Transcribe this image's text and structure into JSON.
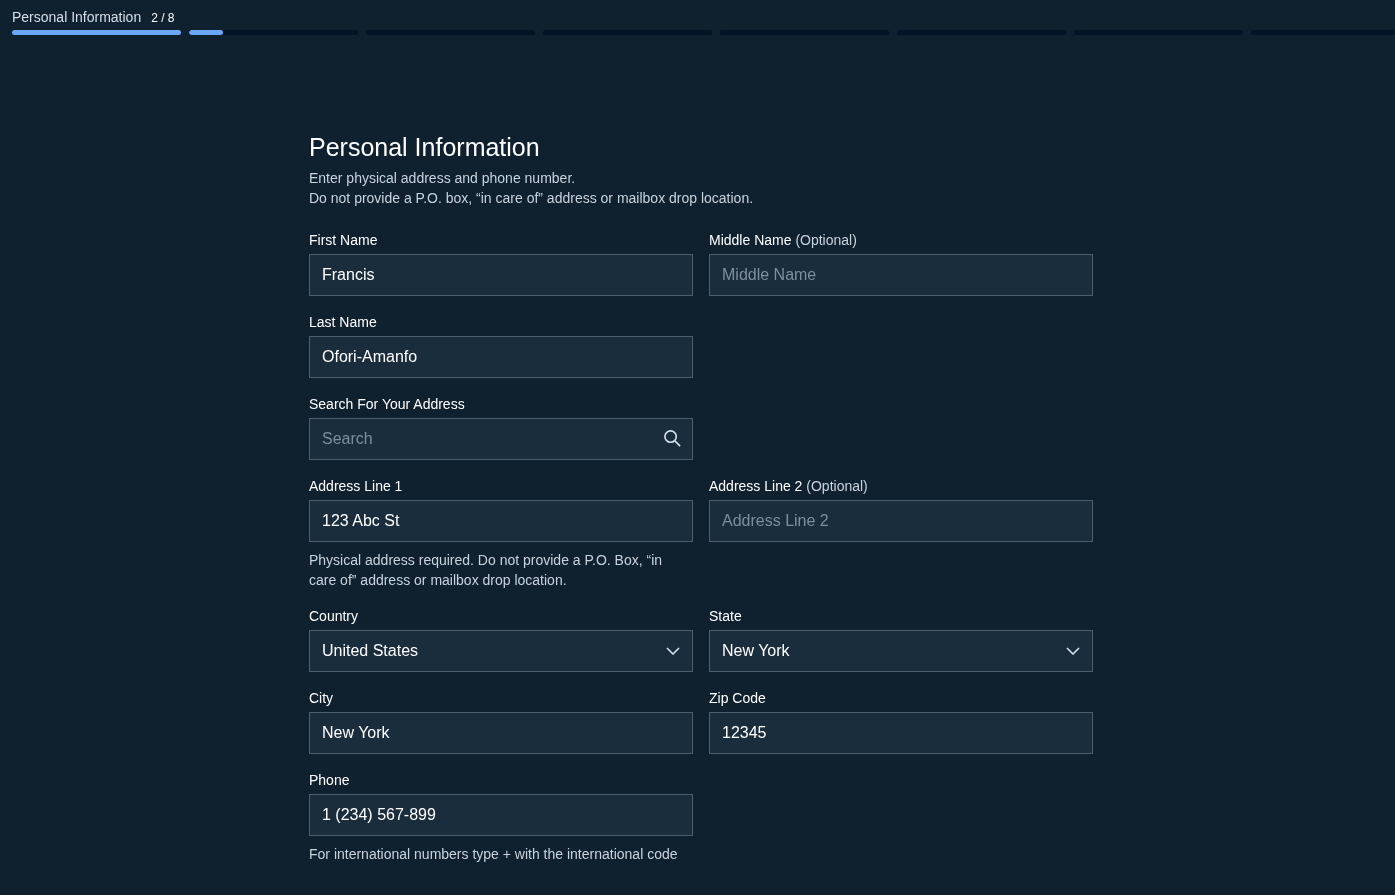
{
  "progress": {
    "label": "Personal Information",
    "count": "2 / 8",
    "segments": [
      {
        "done": true
      },
      {
        "done": false,
        "level": 0.2
      },
      {
        "done": false
      },
      {
        "done": false
      },
      {
        "done": false
      },
      {
        "done": false
      },
      {
        "done": false
      },
      {
        "done": false
      }
    ]
  },
  "form": {
    "title": "Personal Information",
    "intro": [
      "Enter physical address and phone number.",
      "Do not provide a P.O. box, “in care of” address or mailbox drop location."
    ],
    "rows": [
      {
        "fields": [
          {
            "kind": "text",
            "label": "First Name",
            "value": "Francis"
          },
          {
            "kind": "text",
            "label": "Middle Name",
            "optional": "(Optional)",
            "placeholder": "Middle Name"
          }
        ]
      },
      {
        "fields": [
          {
            "kind": "text",
            "label": "Last Name",
            "value": "Ofori-Amanfo"
          }
        ]
      },
      {
        "fields": [
          {
            "kind": "search",
            "label": "Search For Your Address",
            "placeholder": "Search"
          }
        ]
      },
      {
        "fields": [
          {
            "kind": "text",
            "label": "Address Line 1",
            "value": "123 Abc St",
            "hint": "Physical address required. Do not provide a P.O. Box, “in care of” address or mailbox drop location."
          },
          {
            "kind": "text",
            "label": "Address Line 2",
            "optional": "(Optional)",
            "placeholder": "Address Line 2"
          }
        ]
      },
      {
        "fields": [
          {
            "kind": "select",
            "label": "Country",
            "value": "United States"
          },
          {
            "kind": "select",
            "label": "State",
            "value": "New York"
          }
        ]
      },
      {
        "fields": [
          {
            "kind": "text",
            "label": "City",
            "value": "New York"
          },
          {
            "kind": "text",
            "label": "Zip Code",
            "value": "12345"
          }
        ]
      },
      {
        "fields": [
          {
            "kind": "text",
            "label": "Phone",
            "value": "1 (234) 567-899",
            "hint": "For international numbers type + with the international code"
          }
        ]
      }
    ]
  }
}
